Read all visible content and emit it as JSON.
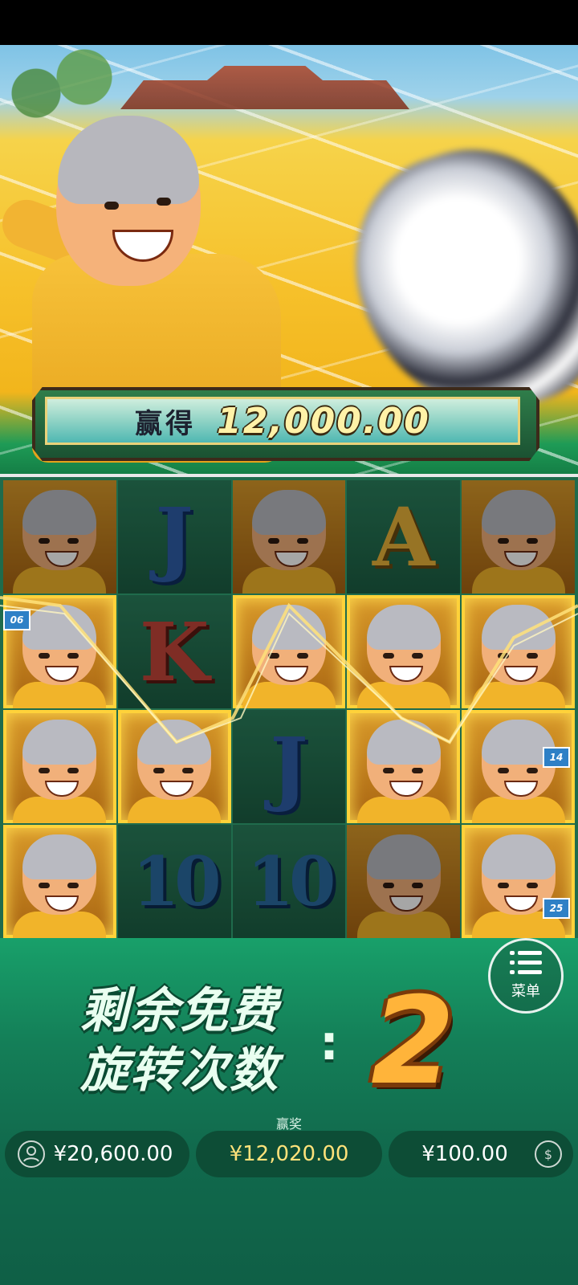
{
  "win_banner": {
    "label": "赢得",
    "amount": "12,000.00"
  },
  "reels": {
    "rows": [
      [
        {
          "sym": "monk",
          "win": false
        },
        {
          "sym": "J",
          "win": false
        },
        {
          "sym": "monk",
          "win": false
        },
        {
          "sym": "A",
          "win": false
        },
        {
          "sym": "monk",
          "win": false
        }
      ],
      [
        {
          "sym": "monk",
          "win": true,
          "badge": "06"
        },
        {
          "sym": "K",
          "win": false
        },
        {
          "sym": "monk",
          "win": true
        },
        {
          "sym": "monk",
          "win": true
        },
        {
          "sym": "monk",
          "win": true
        }
      ],
      [
        {
          "sym": "monk",
          "win": true
        },
        {
          "sym": "monk",
          "win": true
        },
        {
          "sym": "J",
          "win": false
        },
        {
          "sym": "monk",
          "win": true
        },
        {
          "sym": "monk",
          "win": true,
          "badge": "14"
        }
      ],
      [
        {
          "sym": "monk",
          "win": true
        },
        {
          "sym": "10",
          "win": false
        },
        {
          "sym": "10",
          "win": false
        },
        {
          "sym": "monk",
          "win": false
        },
        {
          "sym": "monk",
          "win": true,
          "badge": "25"
        }
      ]
    ]
  },
  "free_spins": {
    "label_line1": "剩余免费",
    "label_line2": "旋转次数",
    "colon": ":",
    "count": "2"
  },
  "menu": {
    "label": "菜单",
    "icon": "menu-list-icon"
  },
  "balance": {
    "value": "¥20,600.00",
    "icon": "user-wallet-icon"
  },
  "win": {
    "caption": "赢奖",
    "value": "¥12,020.00"
  },
  "bet": {
    "value": "¥100.00",
    "icon": "coin-icon"
  },
  "colors": {
    "accent_gold": "#ffd23a",
    "panel_green": "#147f58",
    "count_orange": "#ffb43a"
  }
}
